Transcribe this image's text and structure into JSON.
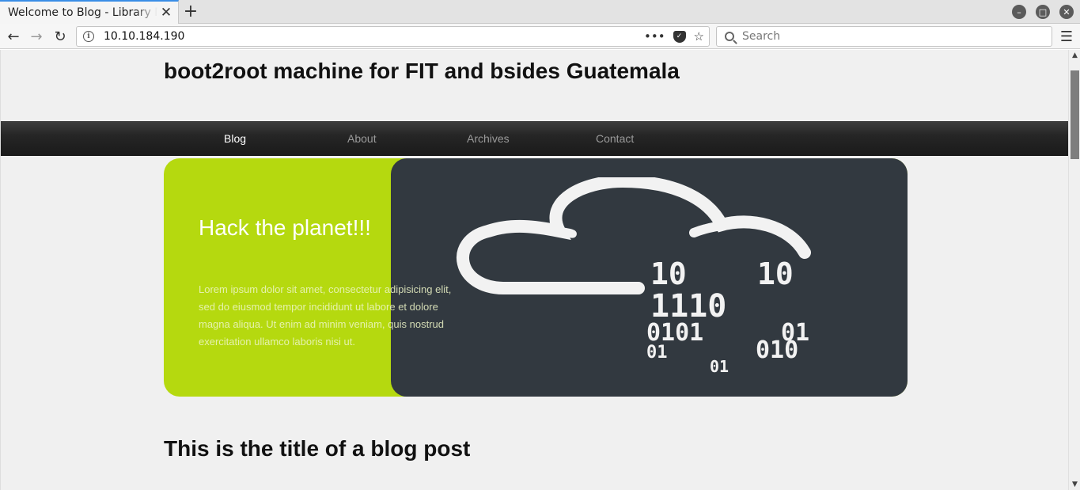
{
  "browser": {
    "tab_title": "Welcome to Blog - Library Machine",
    "new_tab_symbol": "+",
    "url": "10.10.184.190",
    "search_placeholder": "Search",
    "more_dots": "•••"
  },
  "site": {
    "title": "boot2root machine for FIT and bsides Guatemala",
    "nav": [
      "Blog",
      "About",
      "Archives",
      "Contact"
    ],
    "active_nav": "Blog"
  },
  "hero": {
    "heading": "Hack the planet!!!",
    "text": "Lorem ipsum dolor sit amet, consectetur adipisicing elit, sed do eiusmod tempor incididunt ut labore et dolore magna aliqua. Ut enim ad minim veniam, quis nostrud exercitation ullamco laboris nisi ut.",
    "binary_lines": [
      "10",
      "10",
      "1110",
      "0101",
      "01",
      "01",
      "010",
      "01"
    ],
    "colors": {
      "accent": "#b5d90f",
      "dark": "#323940"
    }
  },
  "post": {
    "title": "This is the title of a blog post"
  }
}
